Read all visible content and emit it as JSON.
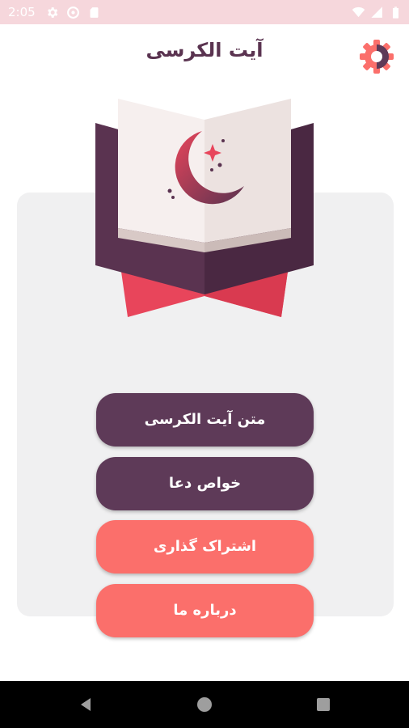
{
  "status_bar": {
    "time": "2:05",
    "left_icons": [
      "gear-icon",
      "vpn-key-icon",
      "sd-card-icon"
    ],
    "right_icons": [
      "wifi-icon",
      "signal-icon",
      "battery-icon"
    ],
    "background": "#f6d7dc"
  },
  "header": {
    "title": "آیت الکرسی",
    "settings_icon": "gear-icon",
    "accent": "#fb6f6b"
  },
  "hero": {
    "image": "open-book-crescent-moon-illustration"
  },
  "menu": {
    "buttons": [
      {
        "label": "متن آیت الکرسی",
        "color": "#5e3a58"
      },
      {
        "label": "خواص دعا",
        "color": "#5e3a58"
      },
      {
        "label": "اشتراک گذاری",
        "color": "#fb6f6b"
      },
      {
        "label": "درباره ما",
        "color": "#fb6f6b"
      }
    ]
  },
  "nav_bar": {
    "items": [
      "back-icon",
      "home-icon",
      "recents-icon"
    ]
  }
}
